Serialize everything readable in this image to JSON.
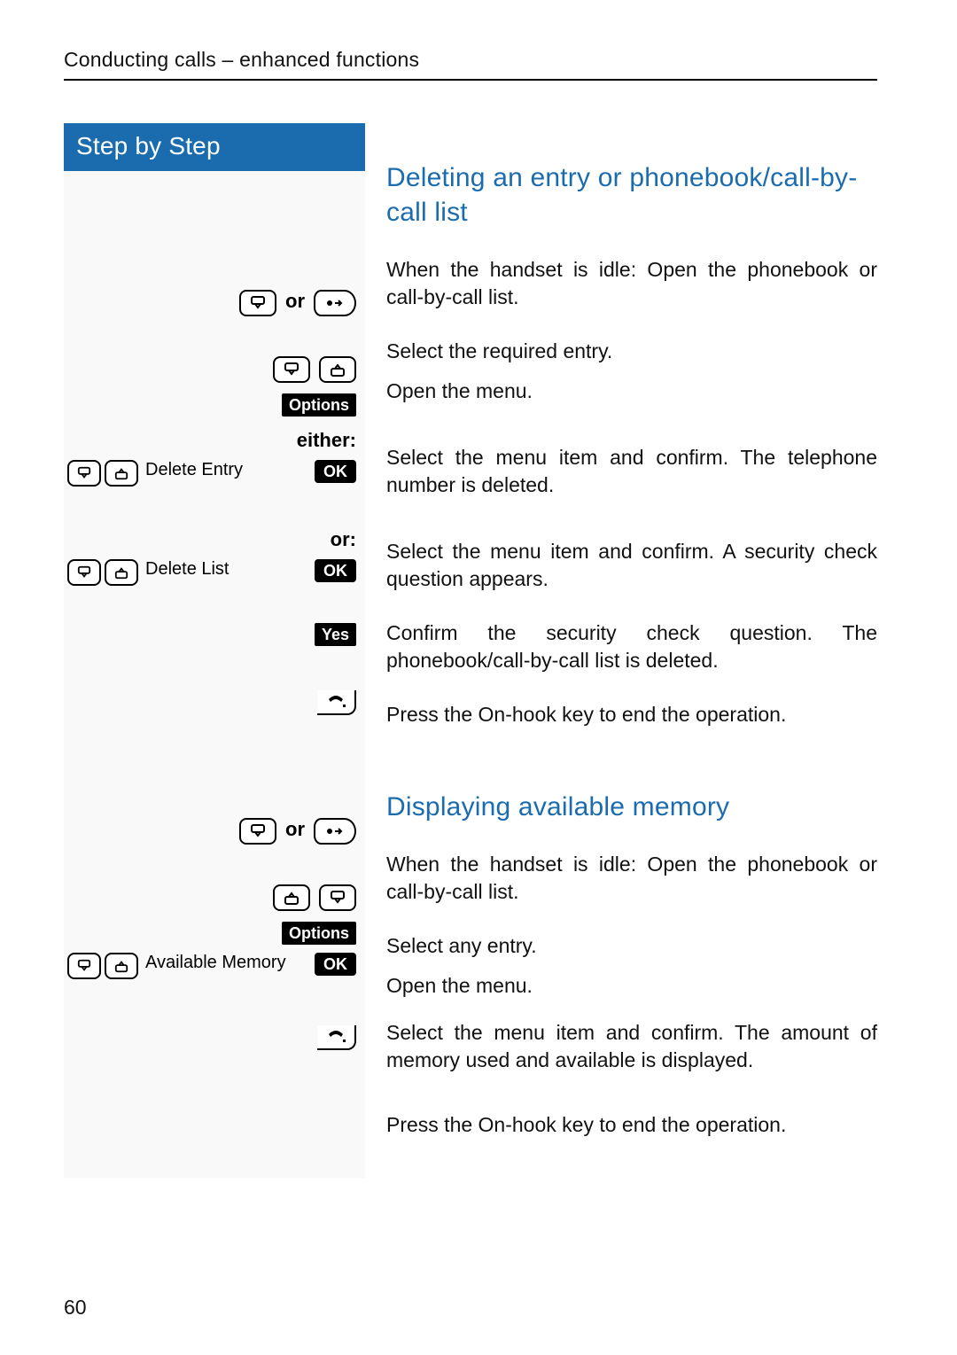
{
  "header": {
    "running": "Conducting calls – enhanced functions"
  },
  "stepHeader": "Step by Step",
  "section1": {
    "title": "Deleting an entry or phonebook/call-by-call list",
    "orWord": "or",
    "openText": "When the handset is idle: Open the phonebook or call-by-call list.",
    "selectEntry": "Select the required entry.",
    "optionsBadge": "Options",
    "openMenu": "Open the menu.",
    "eitherLabel": "either:",
    "deleteEntry": "Delete Entry",
    "okBadge": "OK",
    "confirmDeleteEntry": "Select the menu item and confirm. The telephone number is deleted.",
    "orLabel": "or:",
    "deleteList": "Delete List",
    "confirmDeleteList": "Select the menu item and confirm. A security check question appears.",
    "yesBadge": "Yes",
    "confirmSecurity": "Confirm the security check question. The phonebook/call-by-call list is deleted.",
    "endOperation": "Press the On-hook key to end the operation."
  },
  "section2": {
    "title": "Displaying available memory",
    "orWord": "or",
    "openText": "When the handset is idle: Open the phonebook or call-by-call list.",
    "selectAny": "Select any entry.",
    "optionsBadge": "Options",
    "openMenu": "Open the menu.",
    "availableMemory": "Available Memory",
    "okBadge": "OK",
    "confirmMemory": "Select the menu item and confirm. The amount of memory used and available is displayed.",
    "endOperation": "Press the On-hook key to end the operation."
  },
  "pageNumber": "60"
}
